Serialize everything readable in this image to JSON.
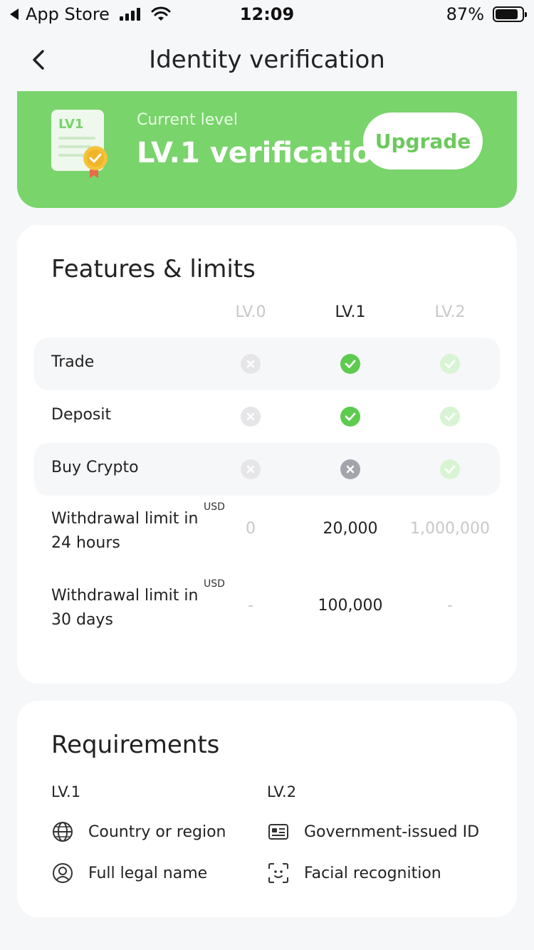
{
  "status": {
    "carrier": "App Store",
    "time": "12:09",
    "battery": "87%",
    "battery_level": 0.87
  },
  "nav": {
    "title": "Identity verification"
  },
  "hero": {
    "badge_text": "LV1",
    "subtitle": "Current level",
    "title": "LV.1 verification",
    "upgrade_label": "Upgrade",
    "accent": "#79d46b"
  },
  "features": {
    "title": "Features & limits",
    "columns": [
      "LV.0",
      "LV.1",
      "LV.2"
    ],
    "rows": [
      {
        "label": "Trade",
        "states": [
          "no",
          "yes",
          "yes-dim"
        ]
      },
      {
        "label": "Deposit",
        "states": [
          "no",
          "yes",
          "yes-dim"
        ]
      },
      {
        "label": "Buy Crypto",
        "states": [
          "no",
          "no-mid",
          "yes-dim"
        ]
      }
    ],
    "limits": [
      {
        "label": "Withdrawal limit in 24 hours",
        "unit": "USD",
        "values": [
          "0",
          "20,000",
          "1,000,000"
        ]
      },
      {
        "label": "Withdrawal limit in 30 days",
        "unit": "USD",
        "values": [
          "-",
          "100,000",
          "-"
        ]
      }
    ]
  },
  "requirements": {
    "title": "Requirements",
    "lv1": {
      "heading": "LV.1",
      "items": [
        {
          "icon": "globe-icon",
          "label": "Country or region"
        },
        {
          "icon": "user-circle-icon",
          "label": "Full legal name"
        }
      ]
    },
    "lv2": {
      "heading": "LV.2",
      "items": [
        {
          "icon": "id-card-icon",
          "label": "Government-issued ID"
        },
        {
          "icon": "face-scan-icon",
          "label": "Facial recognition"
        }
      ]
    }
  }
}
